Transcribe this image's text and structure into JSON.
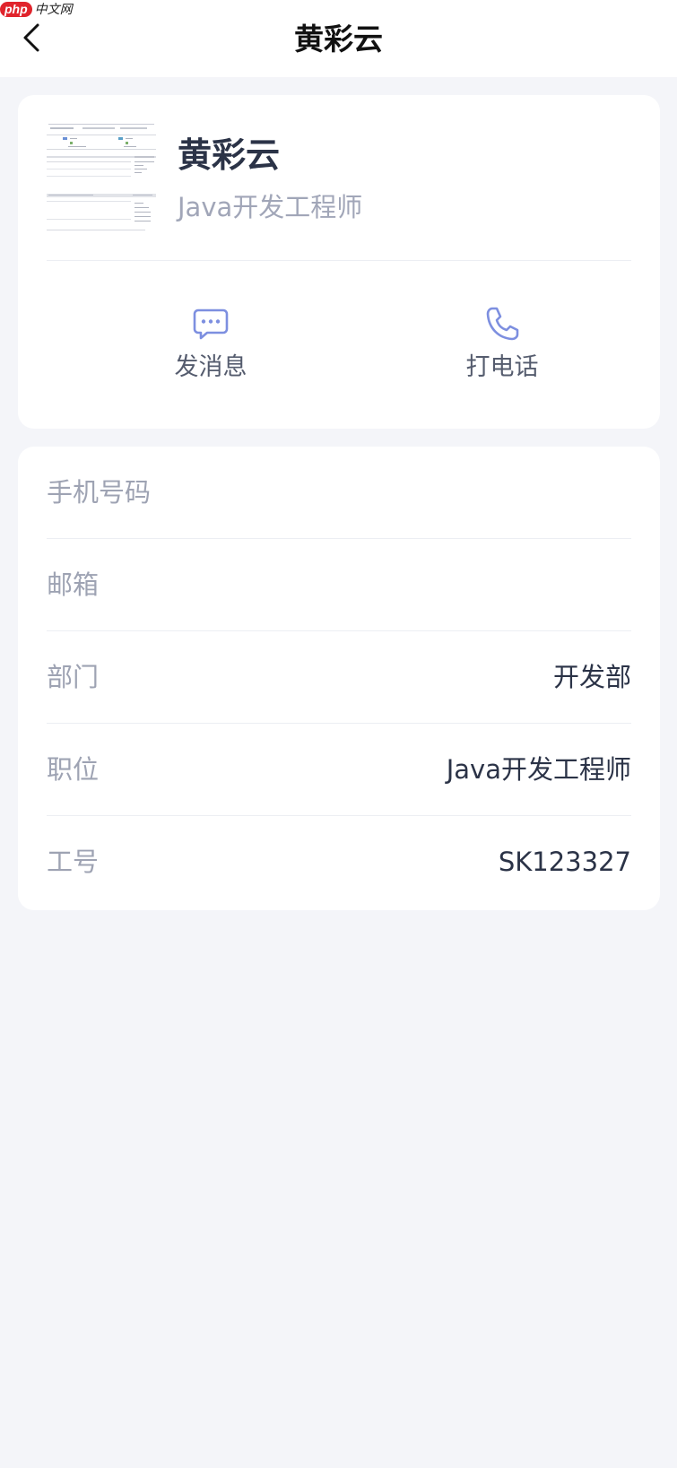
{
  "watermark": {
    "brand": "php",
    "site": "中文网"
  },
  "header": {
    "title": "黄彩云"
  },
  "profile": {
    "name": "黄彩云",
    "position": "Java开发工程师"
  },
  "actions": [
    {
      "label": "发消息",
      "icon": "chat-bubble-icon"
    },
    {
      "label": "打电话",
      "icon": "phone-icon"
    }
  ],
  "details": [
    {
      "label": "手机号码",
      "value": ""
    },
    {
      "label": "邮箱",
      "value": ""
    },
    {
      "label": "部门",
      "value": "开发部"
    },
    {
      "label": "职位",
      "value": "Java开发工程师"
    },
    {
      "label": "工号",
      "value": "SK123327"
    }
  ],
  "colors": {
    "accent": "#7d8fe0",
    "background": "#f4f5f9",
    "card": "#ffffff",
    "primary_text": "#2b3347",
    "secondary_text": "#9ea3b3"
  }
}
